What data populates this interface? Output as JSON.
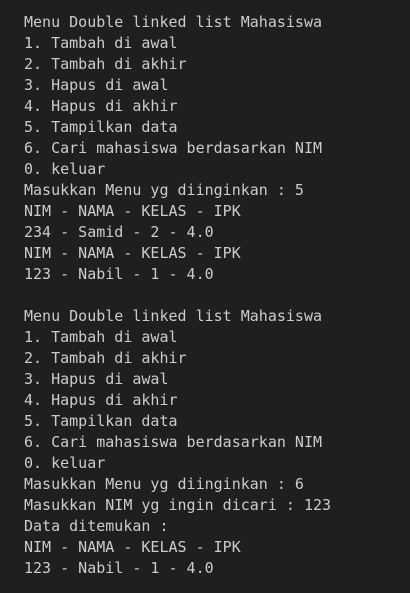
{
  "terminal": {
    "lines": [
      "Menu Double linked list Mahasiswa",
      "1. Tambah di awal",
      "2. Tambah di akhir",
      "3. Hapus di awal",
      "4. Hapus di akhir",
      "5. Tampilkan data",
      "6. Cari mahasiswa berdasarkan NIM",
      "0. keluar",
      "Masukkan Menu yg diinginkan : 5",
      "NIM - NAMA - KELAS - IPK",
      "234 - Samid - 2 - 4.0",
      "NIM - NAMA - KELAS - IPK",
      "123 - Nabil - 1 - 4.0",
      "",
      "Menu Double linked list Mahasiswa",
      "1. Tambah di awal",
      "2. Tambah di akhir",
      "3. Hapus di awal",
      "4. Hapus di akhir",
      "5. Tampilkan data",
      "6. Cari mahasiswa berdasarkan NIM",
      "0. keluar",
      "Masukkan Menu yg diinginkan : 6",
      "Masukkan NIM yg ingin dicari : 123",
      "Data ditemukan :",
      "NIM - NAMA - KELAS - IPK",
      "123 - Nabil - 1 - 4.0"
    ]
  }
}
